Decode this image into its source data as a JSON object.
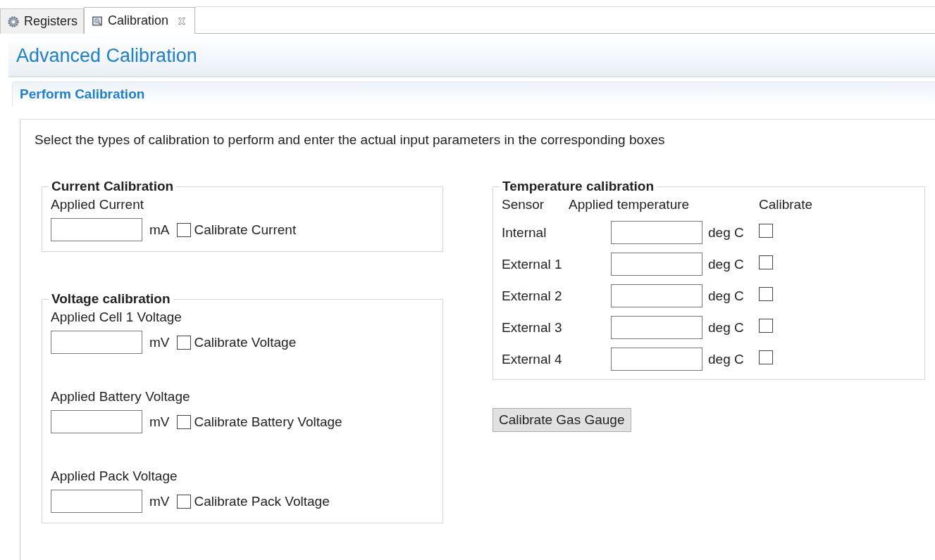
{
  "tabs": [
    {
      "label": "Registers",
      "kind": "gear",
      "closable": false,
      "selected": false
    },
    {
      "label": "Calibration",
      "kind": "magnifier",
      "closable": true,
      "selected": true
    }
  ],
  "page_title": "Advanced Calibration",
  "section_title": "Perform Calibration",
  "instructions": "Select the types of calibration to perform and enter the actual input parameters in the corresponding boxes",
  "current_group": {
    "title": "Current Calibration",
    "fields": [
      {
        "label": "Applied Current",
        "unit": "mA",
        "checkbox": "Calibrate Current",
        "checked": false
      }
    ]
  },
  "voltage_group": {
    "title": "Voltage calibration",
    "fields": [
      {
        "label": "Applied Cell 1 Voltage",
        "unit": "mV",
        "checkbox": "Calibrate Voltage",
        "checked": false
      },
      {
        "label": "Applied Battery Voltage",
        "unit": "mV",
        "checkbox": "Calibrate Battery Voltage",
        "checked": false
      },
      {
        "label": "Applied Pack Voltage",
        "unit": "mV",
        "checkbox": "Calibrate Pack Voltage",
        "checked": false
      }
    ]
  },
  "temperature_group": {
    "title": "Temperature calibration",
    "columns": [
      "Sensor",
      "Applied temperature",
      "Calibrate"
    ],
    "rows": [
      {
        "sensor": "Internal",
        "unit": "deg C",
        "checked": false
      },
      {
        "sensor": "External 1",
        "unit": "deg C",
        "checked": false
      },
      {
        "sensor": "External 2",
        "unit": "deg C",
        "checked": false
      },
      {
        "sensor": "External 3",
        "unit": "deg C",
        "checked": false
      },
      {
        "sensor": "External 4",
        "unit": "deg C",
        "checked": false
      }
    ]
  },
  "button": "Calibrate Gas Gauge"
}
